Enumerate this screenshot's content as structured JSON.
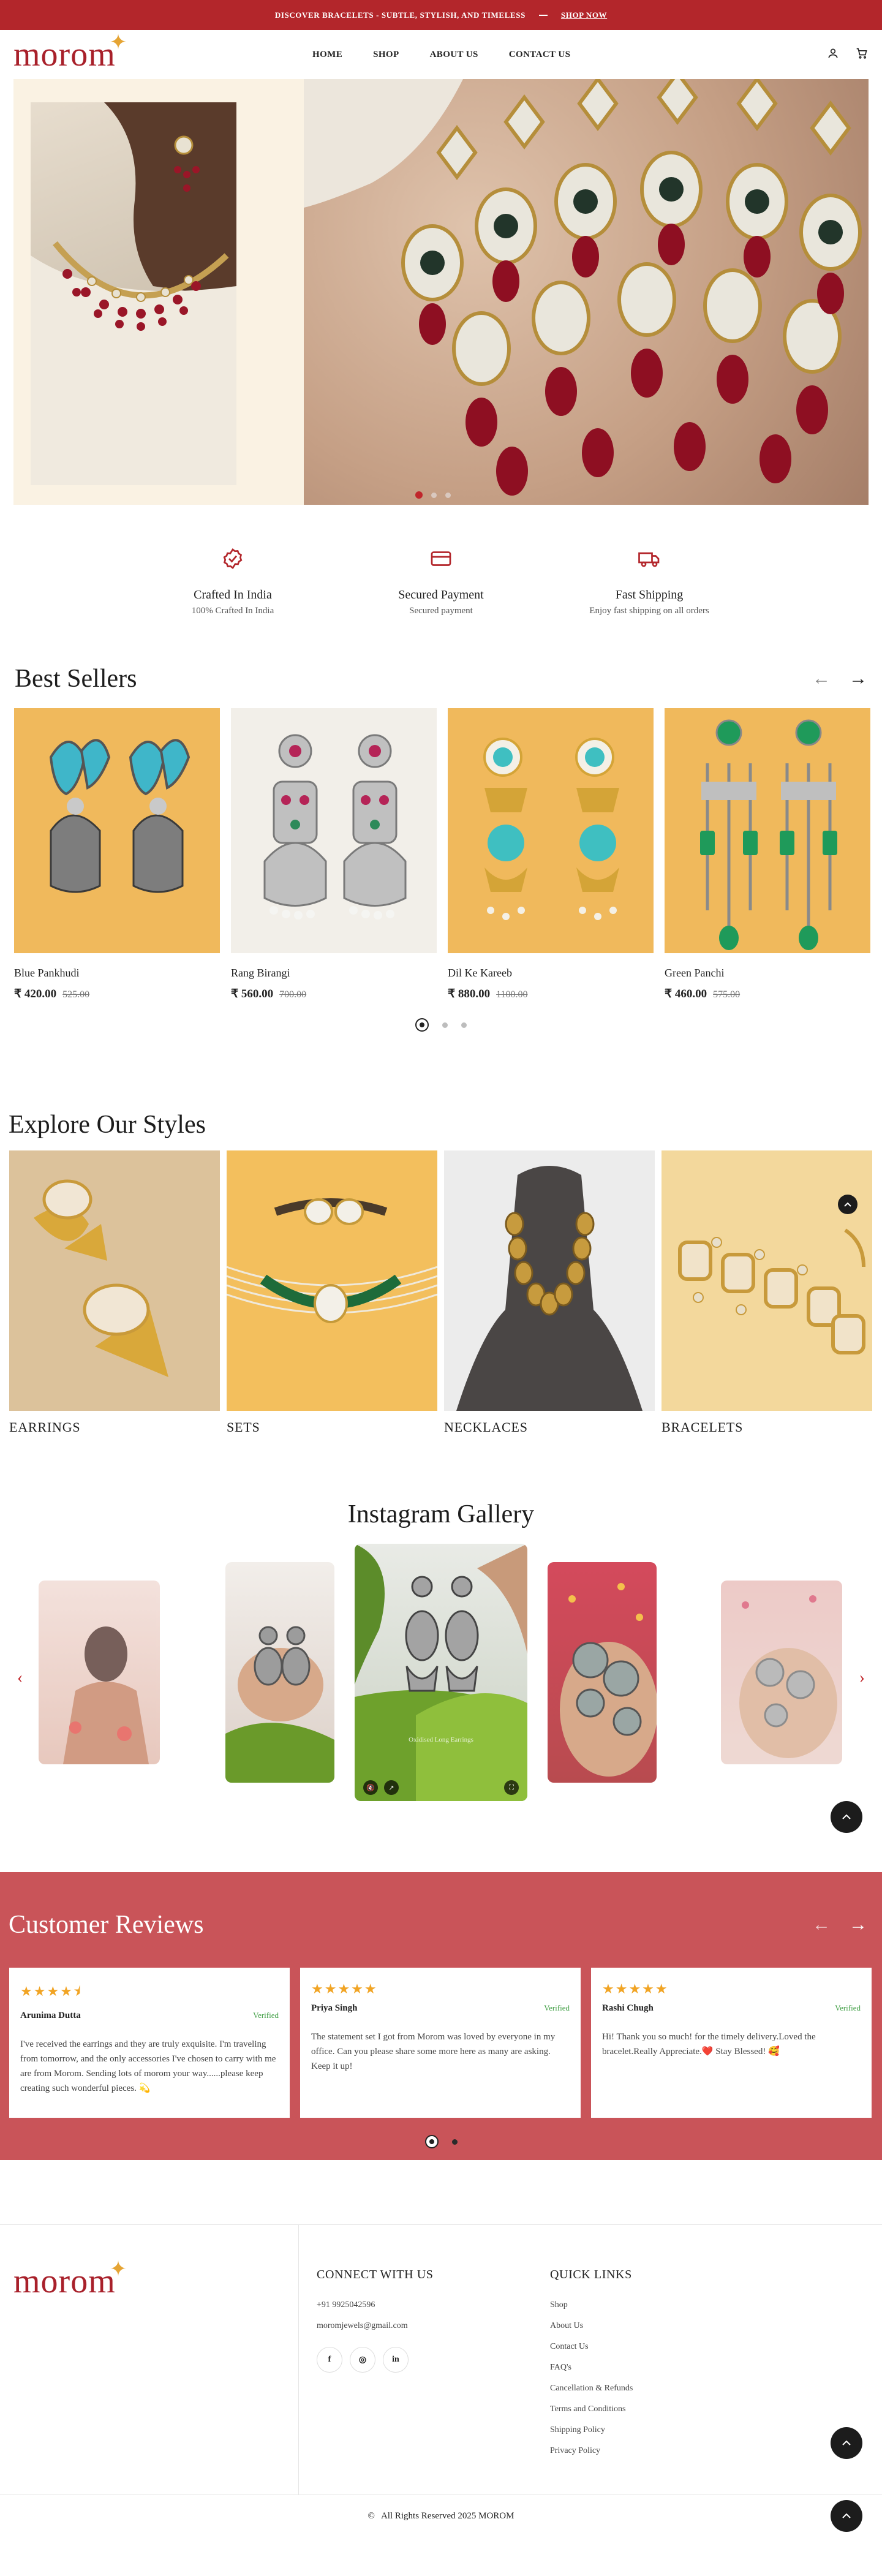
{
  "announcement": {
    "text": "DISCOVER BRACELETS - SUBTLE, STYLISH, AND TIMELESS",
    "cta": "SHOP NOW"
  },
  "header": {
    "logo": "morom",
    "nav": [
      "HOME",
      "SHOP",
      "ABOUT US",
      "CONTACT US"
    ],
    "icons": [
      "account-icon",
      "cart-icon"
    ]
  },
  "hero": {
    "slides": 3,
    "active_slide": 1
  },
  "features": [
    {
      "icon": "badge-check-icon",
      "title": "Crafted In India",
      "subtitle": "100% Crafted In India"
    },
    {
      "icon": "credit-card-icon",
      "title": "Secured Payment",
      "subtitle": "Secured payment"
    },
    {
      "icon": "truck-icon",
      "title": "Fast Shipping",
      "subtitle": "Enjoy fast shipping on all orders"
    }
  ],
  "best_sellers": {
    "title": "Best Sellers",
    "products": [
      {
        "name": "Blue Pankhudi",
        "price": "₹ 420.00",
        "old_price": "525.00"
      },
      {
        "name": "Rang Birangi",
        "price": "₹ 560.00",
        "old_price": "700.00"
      },
      {
        "name": "Dil Ke Kareeb",
        "price": "₹ 880.00",
        "old_price": "1100.00"
      },
      {
        "name": "Green Panchi",
        "price": "₹ 460.00",
        "old_price": "575.00"
      }
    ],
    "pages": 3,
    "active_page": 1
  },
  "styles": {
    "title": "Explore Our Styles",
    "categories": [
      "EARRINGS",
      "SETS",
      "NECKLACES",
      "BRACELETS"
    ]
  },
  "instagram": {
    "title": "Instagram Gallery",
    "reel_caption": "Oxidised Long Earrings"
  },
  "reviews": {
    "title": "Customer Reviews",
    "items": [
      {
        "rating": 4.5,
        "stars": "★★★★⯨",
        "name": "Arunima Dutta",
        "badge": "Verified",
        "text": "I've received the earrings and they are truly exquisite. I'm traveling from tomorrow, and the only accessories I've chosen to carry with me are from Morom. Sending lots of morom your way......please keep creating such wonderful pieces. 💫"
      },
      {
        "rating": 5,
        "stars": "★★★★★",
        "name": "Priya Singh",
        "badge": "Verified",
        "text": "The statement set I got from Morom was loved by everyone in my office. Can you please share some more here as many are asking. Keep it up!"
      },
      {
        "rating": 5,
        "stars": "★★★★★",
        "name": "Rashi Chugh",
        "badge": "Verified",
        "text": "Hi! Thank you so much! for the timely delivery.Loved the bracelet.Really Appreciate.❤️ Stay Blessed! 🥰"
      }
    ],
    "pages": 2,
    "active_page": 1
  },
  "footer": {
    "logo": "morom",
    "connect_title": "CONNECT WITH US",
    "phone": "+91 9925042596",
    "email": "moromjewels@gmail.com",
    "socials": [
      "f",
      "◎",
      "in"
    ],
    "links_title": "QUICK LINKS",
    "links": [
      "Shop",
      "About Us",
      "Contact Us",
      "FAQ's",
      "Cancellation & Refunds",
      "Terms and Conditions",
      "Shipping Policy",
      "Privacy Policy"
    ],
    "copyright": "All Rights Reserved 2025 MOROM"
  },
  "colors": {
    "brand": "#b3262b",
    "reviews_bg": "#c95459",
    "star": "#f1a424",
    "verified": "#43a047",
    "product_bg": "#f0b95c"
  }
}
